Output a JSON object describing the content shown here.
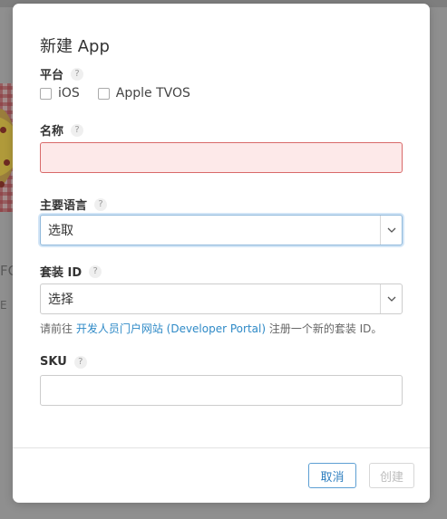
{
  "background": {
    "text_1": "FC",
    "text_2": "E"
  },
  "modal": {
    "title": "新建 App",
    "help_mark": "?",
    "platform": {
      "label": "平台",
      "options": [
        "iOS",
        "Apple TVOS"
      ]
    },
    "name": {
      "label": "名称",
      "value": ""
    },
    "primary_language": {
      "label": "主要语言",
      "selected": "选取"
    },
    "bundle_id": {
      "label": "套装 ID",
      "selected": "选择",
      "hint_prefix": "请前往 ",
      "hint_link": "开发人员门户网站 (Developer Portal)",
      "hint_suffix": " 注册一个新的套装 ID。"
    },
    "sku": {
      "label": "SKU",
      "value": ""
    },
    "buttons": {
      "cancel": "取消",
      "create": "创建"
    }
  },
  "colors": {
    "accent": "#2f8ac7",
    "error_fill": "#fde9e9",
    "error_border": "#d86a6a",
    "disabled_text": "#bdbdbd"
  },
  "icons": {
    "help": "question-circle-icon",
    "select_caret": "chevron-down-icon"
  }
}
